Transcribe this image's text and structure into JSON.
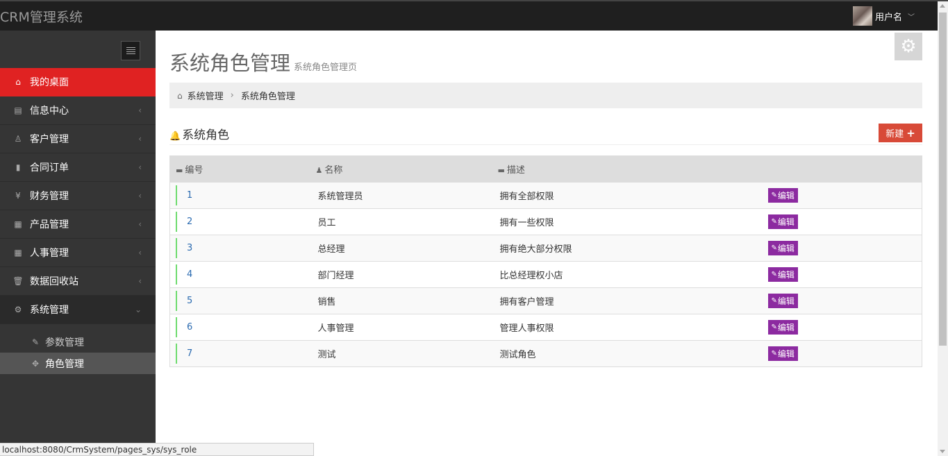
{
  "app": {
    "title": "CRM管理系统"
  },
  "user": {
    "name": "用户名",
    "caret": "﹀"
  },
  "sidebar": {
    "items": [
      {
        "label": "我的桌面",
        "icon": "home-icon",
        "glyph": "⌂",
        "chev": ""
      },
      {
        "label": "信息中心",
        "icon": "inbox-icon",
        "glyph": "▤",
        "chev": "‹"
      },
      {
        "label": "客户管理",
        "icon": "male-icon",
        "glyph": "♙",
        "chev": "‹"
      },
      {
        "label": "合同订单",
        "icon": "book-icon",
        "glyph": "▮",
        "chev": "‹"
      },
      {
        "label": "财务管理",
        "icon": "yen-icon",
        "glyph": "¥",
        "chev": "‹"
      },
      {
        "label": "产品管理",
        "icon": "table-icon",
        "glyph": "▦",
        "chev": "‹"
      },
      {
        "label": "人事管理",
        "icon": "table-icon",
        "glyph": "▦",
        "chev": "‹"
      },
      {
        "label": "数据回收站",
        "icon": "trash-icon",
        "glyph": "🗑",
        "chev": "‹"
      },
      {
        "label": "系统管理",
        "icon": "cog-icon",
        "glyph": "⚙",
        "chev": "⌄"
      }
    ],
    "subitems": [
      {
        "label": "参数管理",
        "icon": "wrench-icon",
        "glyph": "✎"
      },
      {
        "label": "角色管理",
        "icon": "move-icon",
        "glyph": "✥"
      }
    ]
  },
  "page": {
    "title": "系统角色管理",
    "subtitle": "系统角色管理页",
    "gear_glyph": "⚙"
  },
  "breadcrumb": {
    "home_glyph": "⌂",
    "items": [
      "系统管理",
      "系统角色管理"
    ],
    "sep": "›"
  },
  "section": {
    "title": "系统角色",
    "bell_glyph": "🔔",
    "new_label": "新建",
    "plus": "+"
  },
  "table": {
    "headers": [
      {
        "label": "编号",
        "icon": "briefcase-icon",
        "glyph": "▬"
      },
      {
        "label": "名称",
        "icon": "user-icon",
        "glyph": "♟"
      },
      {
        "label": "描述",
        "icon": "cart-icon",
        "glyph": "▬"
      },
      {
        "label": "",
        "icon": "",
        "glyph": ""
      }
    ],
    "edit_label": "编辑",
    "edit_glyph": "✎",
    "rows": [
      {
        "id": "1",
        "name": "系统管理员",
        "desc": "拥有全部权限"
      },
      {
        "id": "2",
        "name": "员工",
        "desc": "拥有一些权限"
      },
      {
        "id": "3",
        "name": "总经理",
        "desc": "拥有绝大部分权限"
      },
      {
        "id": "4",
        "name": "部门经理",
        "desc": "比总经理权小店"
      },
      {
        "id": "5",
        "name": "销售",
        "desc": "拥有客户管理"
      },
      {
        "id": "6",
        "name": "人事管理",
        "desc": "管理人事权限"
      },
      {
        "id": "7",
        "name": "测试",
        "desc": "测试角色"
      }
    ]
  },
  "statusbar": {
    "url": "localhost:8080/CrmSystem/pages_sys/sys_role"
  }
}
